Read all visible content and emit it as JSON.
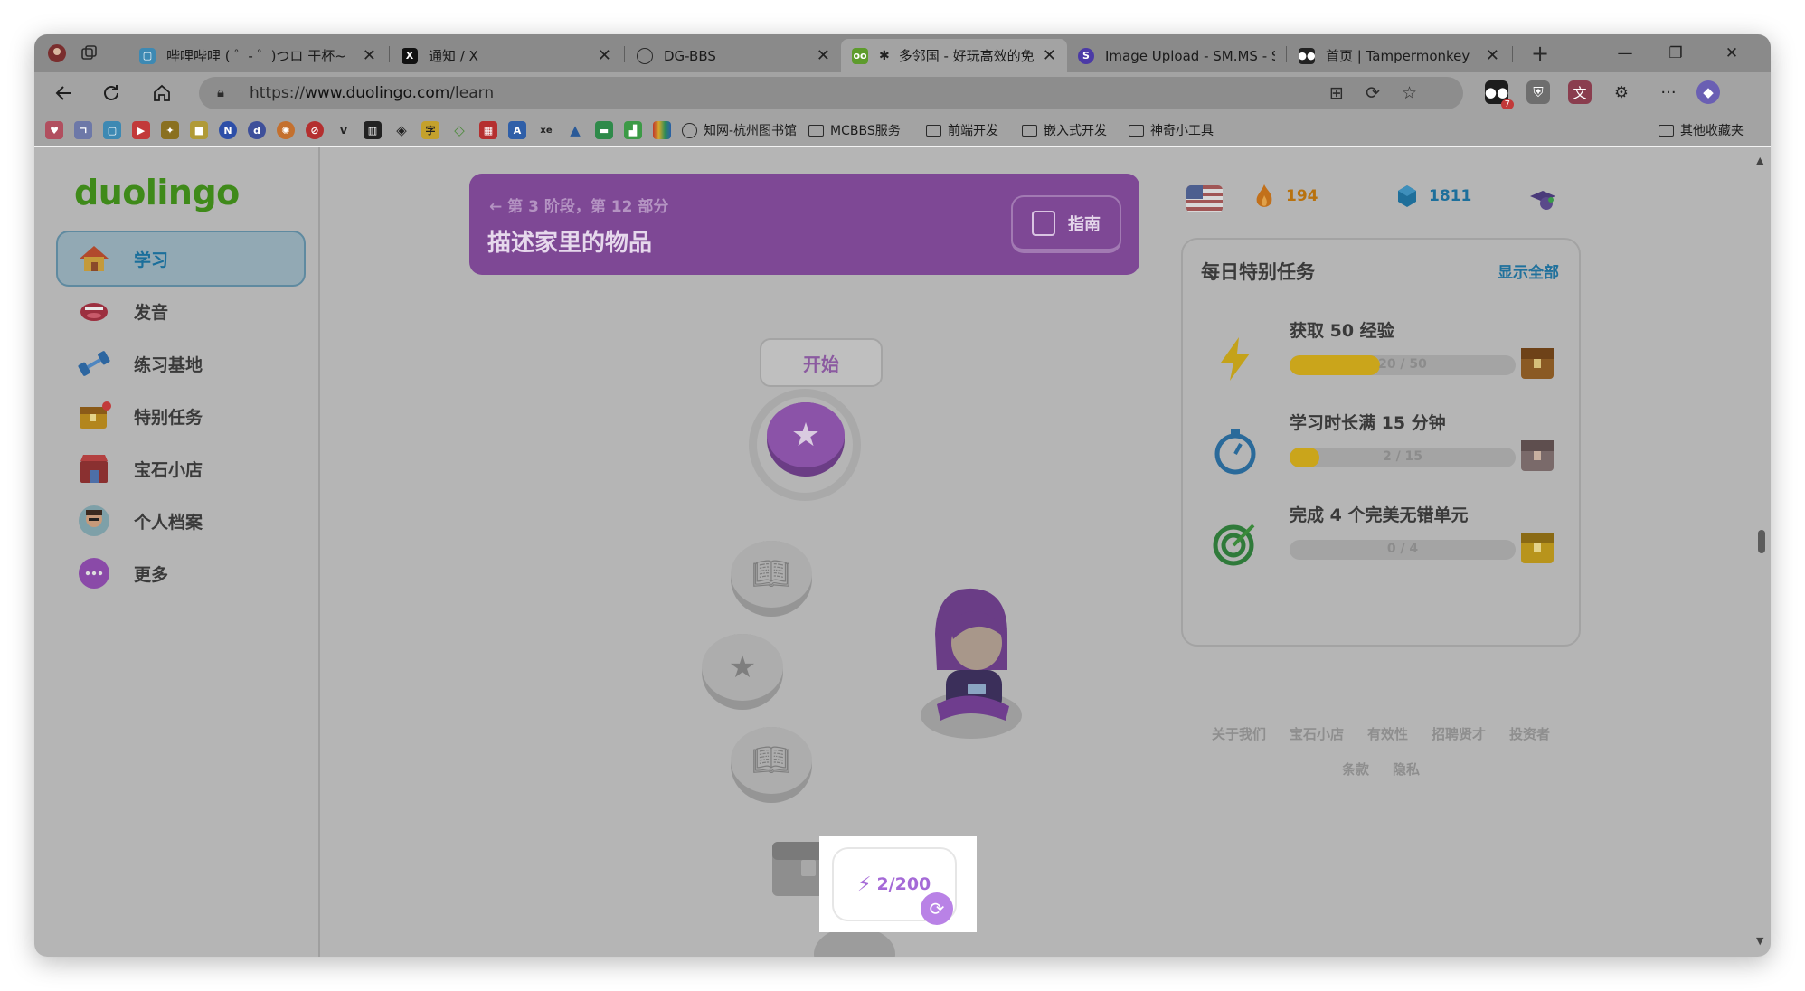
{
  "browser": {
    "tabs": [
      {
        "title": "哔哩哔哩 ( ゜- ゜)つロ 干杯~",
        "favicon": "bilibili-icon",
        "active": false
      },
      {
        "title": "通知 / X",
        "favicon": "x-icon",
        "active": false
      },
      {
        "title": "DG-BBS",
        "favicon": "globe-icon",
        "active": false
      },
      {
        "title": "多邻国 - 好玩高效的免",
        "favicon": "duolingo-icon",
        "active": true
      },
      {
        "title": "Image Upload - SM.MS - S",
        "favicon": "smms-icon",
        "active": false
      },
      {
        "title": "首页 | Tampermonkey",
        "favicon": "tampermonkey-icon",
        "active": false
      }
    ],
    "new_tab": "+",
    "window_controls": {
      "minimize": "—",
      "restore": "❐",
      "close": "✕"
    },
    "url_prefix": "https://",
    "url_host": "www.duolingo.com",
    "url_path": "/learn",
    "extension_badge": "7",
    "bookmarks": {
      "cnki": "知网-杭州图书馆",
      "folders": [
        "MCBBS服务",
        "前端开发",
        "嵌入式开发",
        "神奇小工具"
      ],
      "other": "其他收藏夹"
    }
  },
  "sidebar": {
    "logo": "duolingo",
    "items": [
      {
        "label": "学习",
        "icon": "home-icon",
        "active": true
      },
      {
        "label": "发音",
        "icon": "mouth-icon",
        "active": false
      },
      {
        "label": "练习基地",
        "icon": "dumbbell-icon",
        "active": false
      },
      {
        "label": "特别任务",
        "icon": "chest-icon",
        "active": false
      },
      {
        "label": "宝石小店",
        "icon": "shop-icon",
        "active": false
      },
      {
        "label": "个人档案",
        "icon": "avatar-icon",
        "active": false
      },
      {
        "label": "更多",
        "icon": "more-icon",
        "active": false
      }
    ]
  },
  "unit": {
    "subtitle": "第 3 阶段，第 12 部分",
    "title": "描述家里的物品",
    "guide": "指南"
  },
  "path": {
    "start_label": "开始",
    "xp_popup": "2/200"
  },
  "stats": {
    "streak": "194",
    "gems": "1811"
  },
  "quests": {
    "header": "每日特别任务",
    "show_all": "显示全部",
    "items": [
      {
        "name": "获取 50 经验",
        "progress_text": "20 / 50",
        "progress": 0.4,
        "icon": "lightning-icon"
      },
      {
        "name": "学习时长满 15 分钟",
        "progress_text": "2 / 15",
        "progress": 0.133,
        "icon": "timer-icon"
      },
      {
        "name": "完成 4 个完美无错单元",
        "progress_text": "0 / 4",
        "progress": 0,
        "icon": "target-icon"
      }
    ]
  },
  "footer": {
    "row1": [
      "关于我们",
      "宝石小店",
      "有效性",
      "招聘贤才",
      "投资者"
    ],
    "row2": [
      "条款",
      "隐私"
    ]
  },
  "colors": {
    "brand_green": "#3f8a1a",
    "unit_purple": "#7e4895",
    "xp_purple": "#a56ad7",
    "progress_gold": "#caa51b",
    "link_blue": "#20719c"
  }
}
